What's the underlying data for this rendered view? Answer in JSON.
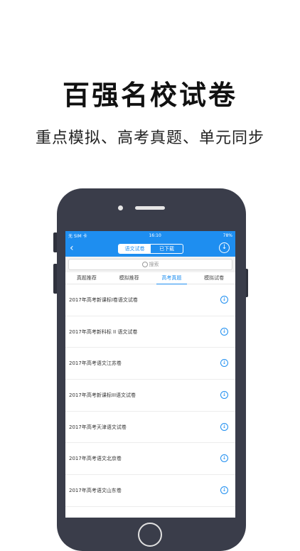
{
  "headline": "百强名校试卷",
  "subheadline": "重点模拟、高考真题、单元同步",
  "status_bar": {
    "carrier": "无 SIM 卡",
    "time": "16:10",
    "battery": "78%"
  },
  "navbar": {
    "back_glyph": "‹",
    "segments": [
      "语文试卷",
      "已下载"
    ],
    "download_glyph": "↓"
  },
  "search": {
    "placeholder": "搜索"
  },
  "tabs": [
    "真题推荐",
    "模拟推荐",
    "高考真题",
    "模拟试卷"
  ],
  "active_tab": "高考真题",
  "papers": [
    "2017年高考新课标I卷语文试卷",
    "2017年高考新科标 II 语文试卷",
    "2017年高考语文江苏卷",
    "2017年高考新课标III语文试卷",
    "2017年高考天津语文试卷",
    "2017年高考语文北京卷",
    "2017年高考语文山东卷"
  ],
  "download_glyph": "↓",
  "colors": {
    "accent": "#1e8ef0",
    "phone_body": "#3a3d4a"
  }
}
